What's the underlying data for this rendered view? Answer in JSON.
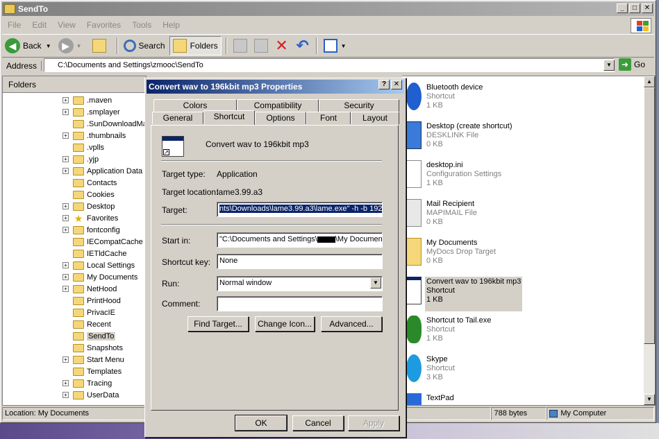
{
  "window": {
    "title": "SendTo"
  },
  "menu": [
    "File",
    "Edit",
    "View",
    "Favorites",
    "Tools",
    "Help"
  ],
  "toolbar": {
    "back": "Back",
    "search": "Search",
    "folders": "Folders"
  },
  "address": {
    "label": "Address",
    "value": "C:\\Documents and Settings\\zmooc\\SendTo",
    "go": "Go"
  },
  "folders_pane": {
    "header": "Folders",
    "items": [
      {
        "label": ".maven",
        "plus": true
      },
      {
        "label": ".smplayer",
        "plus": true
      },
      {
        "label": ".SunDownloadMa",
        "plus": false
      },
      {
        "label": ".thumbnails",
        "plus": true
      },
      {
        "label": ".vplls",
        "plus": false
      },
      {
        "label": ".yjp",
        "plus": true
      },
      {
        "label": "Application Data",
        "plus": true
      },
      {
        "label": "Contacts",
        "plus": false
      },
      {
        "label": "Cookies",
        "plus": false
      },
      {
        "label": "Desktop",
        "plus": true
      },
      {
        "label": "Favorites",
        "plus": true
      },
      {
        "label": "fontconfig",
        "plus": true
      },
      {
        "label": "IECompatCache",
        "plus": false
      },
      {
        "label": "IETldCache",
        "plus": false
      },
      {
        "label": "Local Settings",
        "plus": true
      },
      {
        "label": "My Documents",
        "plus": true
      },
      {
        "label": "NetHood",
        "plus": true
      },
      {
        "label": "PrintHood",
        "plus": false
      },
      {
        "label": "PrivacIE",
        "plus": false
      },
      {
        "label": "Recent",
        "plus": false
      },
      {
        "label": "SendTo",
        "plus": false
      },
      {
        "label": "Snapshots",
        "plus": false
      },
      {
        "label": "Start Menu",
        "plus": true
      },
      {
        "label": "Templates",
        "plus": false
      },
      {
        "label": "Tracing",
        "plus": true
      },
      {
        "label": "UserData",
        "plus": true
      }
    ]
  },
  "files": [
    {
      "name": "Bluetooth device",
      "type": "Shortcut",
      "size": "1 KB",
      "icon": "bluetooth-icon"
    },
    {
      "name": "Desktop (create shortcut)",
      "type": "DESKLINK File",
      "size": "0 KB",
      "icon": "desktop-icon"
    },
    {
      "name": "desktop.ini",
      "type": "Configuration Settings",
      "size": "1 KB",
      "icon": "ini-file-icon"
    },
    {
      "name": "Mail Recipient",
      "type": "MAPIMAIL File",
      "size": "0 KB",
      "icon": "mail-icon"
    },
    {
      "name": "My Documents",
      "type": "MyDocs Drop Target",
      "size": "0 KB",
      "icon": "my-documents-icon"
    },
    {
      "name": "Convert wav to 196kbit mp3",
      "type": "Shortcut",
      "size": "1 KB",
      "icon": "shortcut-app-icon"
    },
    {
      "name": "Shortcut to Tail.exe",
      "type": "Shortcut",
      "size": "1 KB",
      "icon": "tail-icon"
    },
    {
      "name": "Skype",
      "type": "Shortcut",
      "size": "3 KB",
      "icon": "skype-icon"
    },
    {
      "name": "TextPad",
      "type": "",
      "size": "",
      "icon": "textpad-icon"
    }
  ],
  "statusbar": {
    "location": "Location: My Documents",
    "size": "788 bytes",
    "zone": "My Computer"
  },
  "dialog": {
    "title": "Convert wav to 196kbit mp3 Properties",
    "tabs_row1": [
      "Colors",
      "Compatibility",
      "Security"
    ],
    "tabs_row2": [
      "General",
      "Shortcut",
      "Options",
      "Font",
      "Layout"
    ],
    "name": "Convert wav to 196kbit mp3",
    "target_type_label": "Target type:",
    "target_type": "Application",
    "target_location_label": "Target location:",
    "target_location": "lame3.99.a3",
    "target_label": "Target:",
    "target": "nts\\Downloads\\lame3.99.a3\\lame.exe\" -h -b 192",
    "start_in_label": "Start in:",
    "start_in_prefix": "\"C:\\Documents and Settings\\",
    "start_in_suffix": "\\My Documen",
    "shortcut_key_label": "Shortcut key:",
    "shortcut_key": "None",
    "run_label": "Run:",
    "run": "Normal window",
    "comment_label": "Comment:",
    "comment": "",
    "find_target": "Find Target...",
    "change_icon": "Change Icon...",
    "advanced": "Advanced...",
    "ok": "OK",
    "cancel": "Cancel",
    "apply": "Apply"
  }
}
